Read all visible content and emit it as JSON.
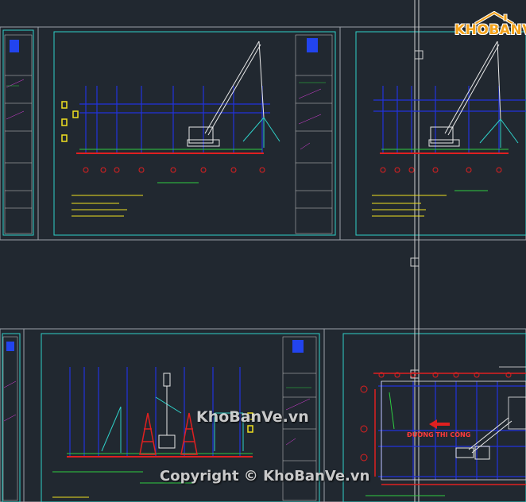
{
  "watermark": {
    "logo_text": "KHOBANVE",
    "center_text": "KhoBanVe.vn",
    "copyright_text": "Copyright © KhoBanVe.vn"
  },
  "drawing": {
    "route_label": "ĐƯỜNG THI CÔNG"
  },
  "colors": {
    "background": "#212830",
    "frame": "#2fd0c8",
    "grid_blue": "#2233dd",
    "green": "#2ecc40",
    "red": "#e02020",
    "white": "#e8e8e8",
    "magenta": "#e040e0",
    "yellow": "#f0e020",
    "logo_orange": "#f3a21b"
  },
  "icons": {
    "logo": "house-roof-icon",
    "crane": "crane-icon",
    "arrow": "left-arrow-icon"
  }
}
